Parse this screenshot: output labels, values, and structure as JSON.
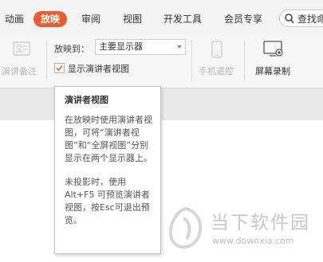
{
  "tabs": [
    {
      "label": "动画",
      "active": false
    },
    {
      "label": "放映",
      "active": true
    },
    {
      "label": "审阅",
      "active": false
    },
    {
      "label": "视图",
      "active": false
    },
    {
      "label": "开发工具",
      "active": false
    },
    {
      "label": "会员专享",
      "active": false
    }
  ],
  "search": {
    "text": "查找命"
  },
  "ribbon": {
    "notes_label": "演讲备注",
    "show_on_label": "放映到：",
    "monitor_value": "主要显示器",
    "presenter_view_label": "显示演讲者视图",
    "presenter_view_checked": true,
    "remote_label": "手机遥控",
    "record_label": "屏幕录制"
  },
  "tooltip": {
    "title": "演讲者视图",
    "para1": "在放映时使用演讲者视图，可将“演讲者视图”和“全屏视图”分别显示在两个显示器上。",
    "para2": "未投影时，使用Alt+F5 可预览演讲者视图，按Esc可退出预览。"
  },
  "watermark": {
    "title": "当下软件园",
    "url": "www.downxia.com"
  },
  "colors": {
    "accent": "#ea5d2c"
  }
}
